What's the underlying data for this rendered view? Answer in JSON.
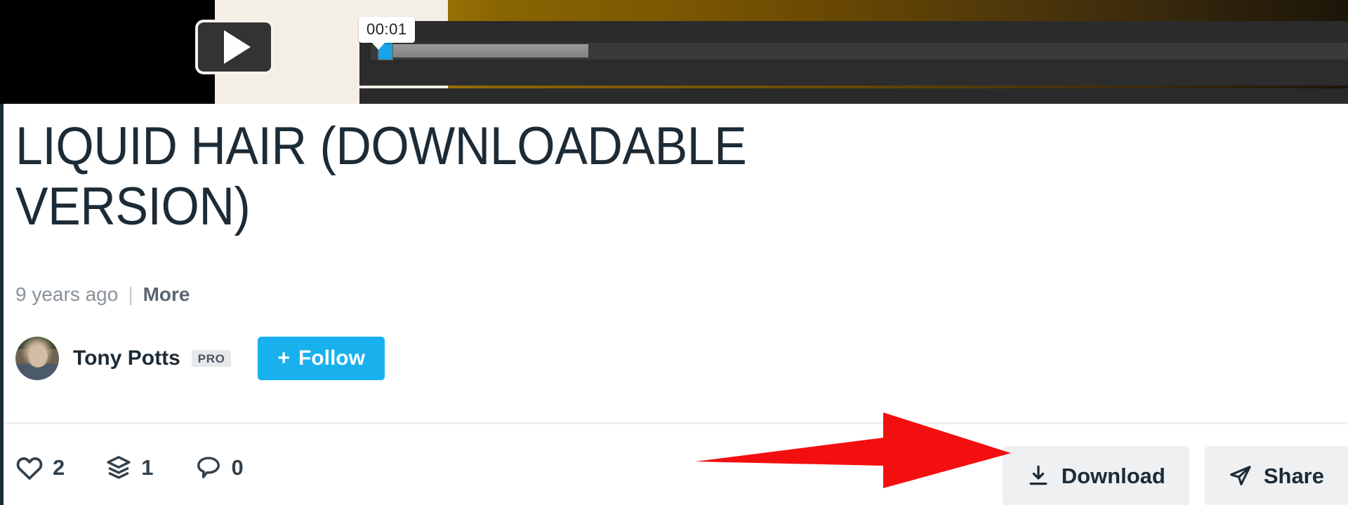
{
  "player": {
    "play_button_label": "Play",
    "timecode": "00:01",
    "progress_percent": 20
  },
  "video": {
    "title": "LIQUID HAIR (DOWNLOADABLE\nVERSION)"
  },
  "meta": {
    "uploaded": "9 years ago",
    "separator": "|",
    "more_label": "More"
  },
  "author": {
    "name": "Tony Potts",
    "badge": "PRO",
    "follow_label": "Follow",
    "follow_plus": "+"
  },
  "stats": [
    {
      "icon": "heart-icon",
      "count": "2"
    },
    {
      "icon": "collections-icon",
      "count": "1"
    },
    {
      "icon": "comment-icon",
      "count": "0"
    }
  ],
  "actions": {
    "download_label": "Download",
    "share_label": "Share"
  },
  "colors": {
    "accent_blue": "#19b1ed",
    "scrubber_blue": "#17a3e8",
    "title_navy": "#1c2b36",
    "annotation_red": "#f30f0f",
    "button_gray": "#eef0f2"
  }
}
